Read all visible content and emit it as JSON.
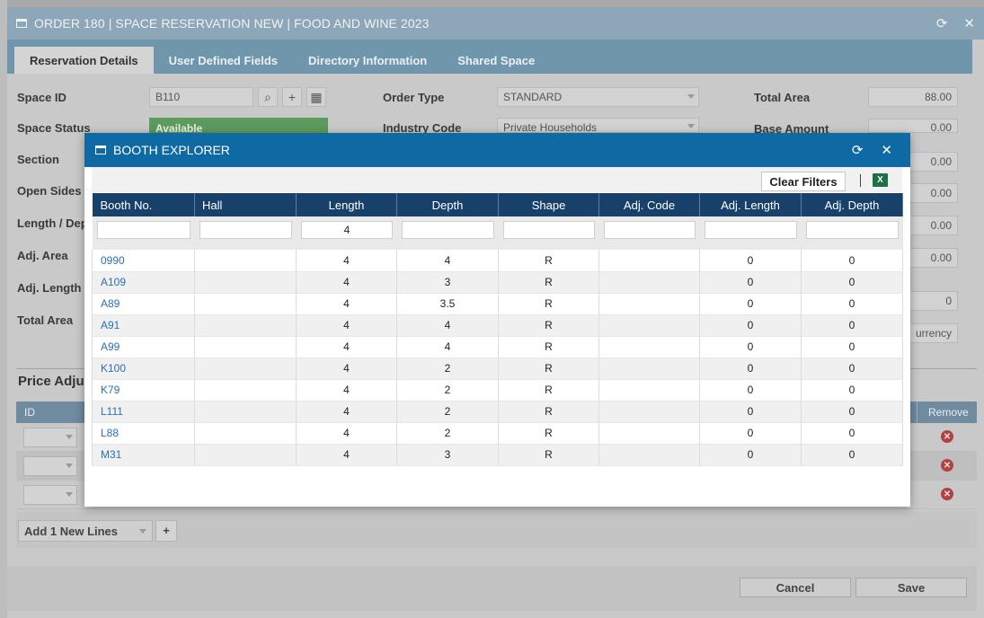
{
  "window": {
    "title": "ORDER 180 | SPACE RESERVATION NEW | FOOD AND WINE 2023"
  },
  "tabs": [
    {
      "label": "Reservation Details",
      "active": true
    },
    {
      "label": "User Defined Fields",
      "active": false
    },
    {
      "label": "Directory Information",
      "active": false
    },
    {
      "label": "Shared Space",
      "active": false
    }
  ],
  "form": {
    "space_id_label": "Space ID",
    "space_id_value": "B110",
    "space_status_label": "Space Status",
    "space_status_value": "Available",
    "section_label": "Section",
    "open_sides_label": "Open Sides",
    "length_depth_label": "Length / Depth",
    "adj_area_label": "Adj. Area",
    "adj_length_label": "Adj. Length",
    "total_area_left_label": "Total Area",
    "order_type_label": "Order Type",
    "order_type_value": "STANDARD",
    "industry_code_label": "Industry Code",
    "industry_code_value": "Private Households",
    "total_area_label": "Total Area",
    "total_area_value": "88.00",
    "base_amount_label": "Base Amount",
    "base_amount_value": "0.00",
    "right_values": [
      "0.00",
      "0.00",
      "0.00",
      "0.00"
    ],
    "right_small_value": "0",
    "currency_button": "urrency"
  },
  "price_adjustments": {
    "title": "Price Adju",
    "id_header": "ID",
    "remove_header": "Remove"
  },
  "add_lines": {
    "label": "Add 1 New Lines",
    "plus": "+"
  },
  "footer": {
    "cancel": "Cancel",
    "save": "Save"
  },
  "booth_explorer": {
    "title": "BOOTH EXPLORER",
    "clear_filters": "Clear Filters",
    "columns": [
      "Booth No.",
      "Hall",
      "Length",
      "Depth",
      "Shape",
      "Adj. Code",
      "Adj. Length",
      "Adj. Depth"
    ],
    "filters": [
      "",
      "",
      "4",
      "",
      "",
      "",
      "",
      ""
    ],
    "rows": [
      {
        "booth": "0990",
        "hall": "",
        "length": "4",
        "depth": "4",
        "shape": "R",
        "adj_code": "",
        "adj_length": "0",
        "adj_depth": "0"
      },
      {
        "booth": "A109",
        "hall": "",
        "length": "4",
        "depth": "3",
        "shape": "R",
        "adj_code": "",
        "adj_length": "0",
        "adj_depth": "0"
      },
      {
        "booth": "A89",
        "hall": "",
        "length": "4",
        "depth": "3.5",
        "shape": "R",
        "adj_code": "",
        "adj_length": "0",
        "adj_depth": "0"
      },
      {
        "booth": "A91",
        "hall": "",
        "length": "4",
        "depth": "4",
        "shape": "R",
        "adj_code": "",
        "adj_length": "0",
        "adj_depth": "0"
      },
      {
        "booth": "A99",
        "hall": "",
        "length": "4",
        "depth": "4",
        "shape": "R",
        "adj_code": "",
        "adj_length": "0",
        "adj_depth": "0"
      },
      {
        "booth": "K100",
        "hall": "",
        "length": "4",
        "depth": "2",
        "shape": "R",
        "adj_code": "",
        "adj_length": "0",
        "adj_depth": "0"
      },
      {
        "booth": "K79",
        "hall": "",
        "length": "4",
        "depth": "2",
        "shape": "R",
        "adj_code": "",
        "adj_length": "0",
        "adj_depth": "0"
      },
      {
        "booth": "L111",
        "hall": "",
        "length": "4",
        "depth": "2",
        "shape": "R",
        "adj_code": "",
        "adj_length": "0",
        "adj_depth": "0"
      },
      {
        "booth": "L88",
        "hall": "",
        "length": "4",
        "depth": "2",
        "shape": "R",
        "adj_code": "",
        "adj_length": "0",
        "adj_depth": "0"
      },
      {
        "booth": "M31",
        "hall": "",
        "length": "4",
        "depth": "3",
        "shape": "R",
        "adj_code": "",
        "adj_length": "0",
        "adj_depth": "0"
      }
    ]
  },
  "colors": {
    "booth_header": "#0f6aa3",
    "grid_header": "#17406b",
    "link": "#2c6fb3",
    "available": "#5d9a5d",
    "excel": "#1e7144"
  }
}
